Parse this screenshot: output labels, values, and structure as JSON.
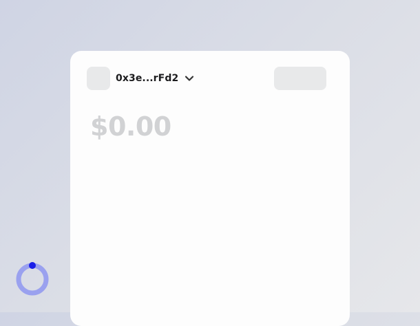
{
  "wallet": {
    "address_short": "0x3e...rFd2",
    "balance": "$0.00"
  },
  "icons": {
    "address_dropdown": "chevron-down-icon",
    "loading": "loading-spinner-icon"
  },
  "colors": {
    "background_start": "#cfd4e4",
    "background_end": "#e6e7ea",
    "card": "#fdfdfd",
    "placeholder": "#e8e9ea",
    "balance_text": "#d1d2d4",
    "spinner_ring": "#9aa1ef",
    "spinner_dot": "#1a1ee8"
  }
}
